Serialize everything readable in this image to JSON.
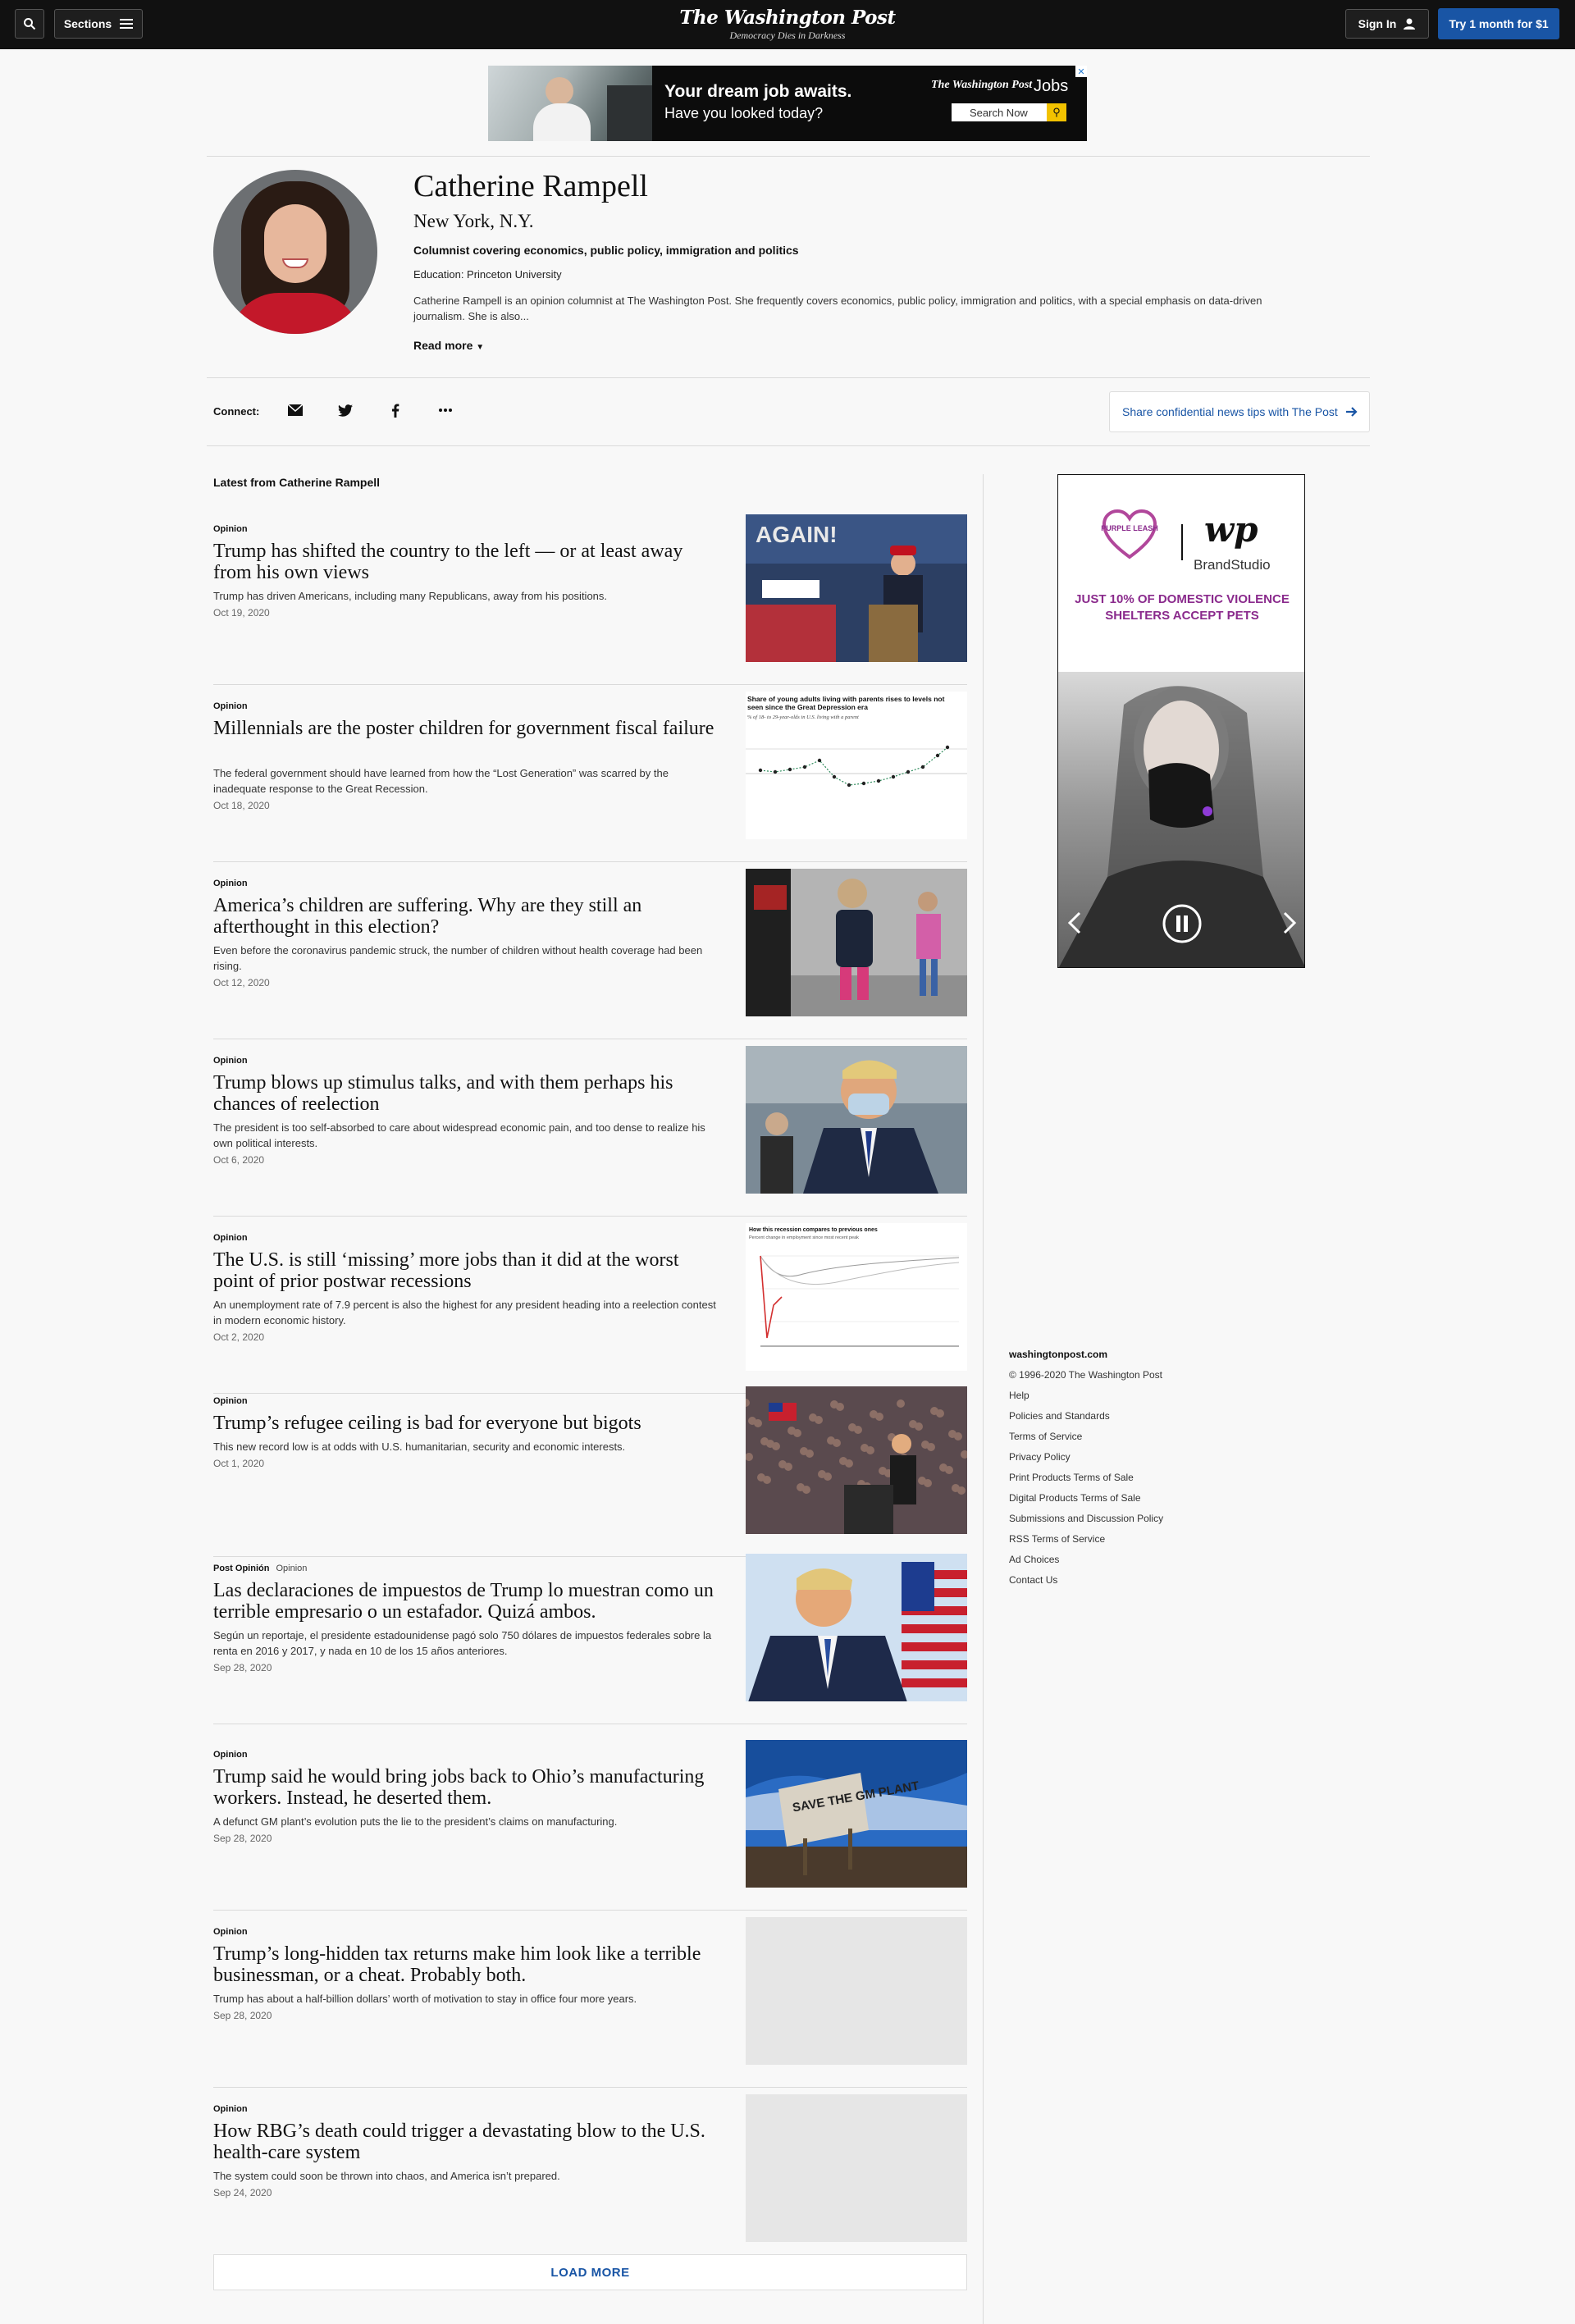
{
  "header": {
    "sections_label": "Sections",
    "brand": "The Washington Post",
    "tagline": "Democracy Dies in Darkness",
    "signin_label": "Sign In",
    "trial_label": "Try 1 month for $1",
    "icons": [
      "search-icon",
      "hamburger-icon",
      "user-icon"
    ]
  },
  "banner_ad": {
    "headline": "Your dream job awaits.",
    "subline": "Have you looked today?",
    "brand": "The Washington Post",
    "brand_suffix": "Jobs",
    "search_label": "Search Now"
  },
  "profile": {
    "name": "Catherine Rampell",
    "location": "New York, N.Y.",
    "role": "Columnist covering economics, public policy, immigration and politics",
    "education": "Education: Princeton University",
    "bio": "Catherine Rampell is an opinion columnist at The Washington Post. She frequently covers economics, public policy, immigration and politics, with a special emphasis on data-driven journalism. She is also...",
    "read_more": "Read more"
  },
  "connect": {
    "label": "Connect:",
    "icons": [
      "email-icon",
      "twitter-icon",
      "facebook-icon",
      "more-icon"
    ],
    "tips_label": "Share confidential news tips with The Post"
  },
  "latest_title": "Latest from Catherine Rampell",
  "articles": [
    {
      "kicker": "Opinion",
      "kicker_sub": "",
      "headline": "Trump has shifted the country to the left — or at least away from his own views",
      "blurb": "Trump has driven Americans, including many Republicans, away from his positions.",
      "date": "Oct 19, 2020",
      "image": "again-rally"
    },
    {
      "kicker": "Opinion",
      "kicker_sub": "",
      "headline": "Millennials are the poster children for government fiscal failure",
      "blurb": "The federal government should have learned from how the “Lost Generation” was scarred by the inadequate response to the Great Recession.",
      "date": "Oct 18, 2020",
      "image": "chart-young-adults"
    },
    {
      "kicker": "Opinion",
      "kicker_sub": "",
      "headline": "America’s children are suffering. Why are they still an afterthought in this election?",
      "blurb": "Even before the coronavirus pandemic struck, the number of children without health coverage had been rising.",
      "date": "Oct 12, 2020",
      "image": "children-walking"
    },
    {
      "kicker": "Opinion",
      "kicker_sub": "",
      "headline": "Trump blows up stimulus talks, and with them perhaps his chances of reelection",
      "blurb": "The president is too self-absorbed to care about widespread economic pain, and too dense to realize his own political interests.",
      "date": "Oct 6, 2020",
      "image": "trump-mask"
    },
    {
      "kicker": "Opinion",
      "kicker_sub": "",
      "headline": "The U.S. is still ‘missing’ more jobs than it did at the worst point of prior postwar recessions",
      "blurb": "An unemployment rate of 7.9 percent is also the highest for any president heading into a reelection contest in modern economic history.",
      "date": "Oct 2, 2020",
      "image": "chart-recession"
    },
    {
      "kicker": "Opinion",
      "kicker_sub": "",
      "headline": "Trump’s refugee ceiling is bad for everyone but bigots",
      "blurb": "This new record low is at odds with U.S. humanitarian, security and economic interests.",
      "date": "Oct 1, 2020",
      "image": "rally-crowd"
    },
    {
      "kicker": "Post Opinión",
      "kicker_sub": "Opinion",
      "headline": "Las declaraciones de impuestos de Trump lo muestran como un terrible empresario o un estafador. Quizá ambos.",
      "blurb": "Según un reportaje, el presidente estadounidense pagó solo 750 dólares de impuestos federales sobre la renta en 2016 y 2017, y nada en 10 de los 15 años anteriores.",
      "date": "Sep 28, 2020",
      "image": "trump-flag"
    },
    {
      "kicker": "Opinion",
      "kicker_sub": "",
      "headline": "Trump said he would bring jobs back to Ohio’s manufacturing workers. Instead, he deserted them.",
      "blurb": "A defunct GM plant’s evolution puts the lie to the president’s claims on manufacturing.",
      "date": "Sep 28, 2020",
      "image": "save-gm-plant"
    },
    {
      "kicker": "Opinion",
      "kicker_sub": "",
      "headline": "Trump’s long-hidden tax returns make him look like a terrible businessman, or a cheat. Probably both.",
      "blurb": "Trump has about a half-billion dollars’ worth of motivation to stay in office four more years.",
      "date": "Sep 28, 2020",
      "image": "placeholder"
    },
    {
      "kicker": "Opinion",
      "kicker_sub": "",
      "headline": "How RBG’s death could trigger a devastating blow to the U.S. health-care system",
      "blurb": "The system could soon be thrown into chaos, and America isn’t prepared.",
      "date": "Sep 24, 2020",
      "image": "placeholder"
    }
  ],
  "thumb_text": {
    "again": "AGAIN!",
    "chart1_title": "Share of young adults living with parents rises to levels not seen since the Great Depression era",
    "chart1_sub": "% of 18- to 29-year-olds in U.S. living with a parent",
    "chart2_title": "How this recession compares to previous ones",
    "chart2_sub": "Percent change in employment since most recent peak",
    "sign": "SAVE THE GM PLANT"
  },
  "side_ad": {
    "logo_left": "PURPLE LEASH",
    "logo_right": "wp",
    "logo_right_sub": "BrandStudio",
    "claim": "JUST 10% OF DOMESTIC VIOLENCE SHELTERS ACCEPT PETS"
  },
  "footer": {
    "site": "washingtonpost.com",
    "copyright": "© 1996-2020 The Washington Post",
    "links": [
      "Help",
      "Policies and Standards",
      "Terms of Service",
      "Privacy Policy",
      "Print Products Terms of Sale",
      "Digital Products Terms of Sale",
      "Submissions and Discussion Policy",
      "RSS Terms of Service",
      "Ad Choices",
      "Contact Us"
    ]
  },
  "load_more": "LOAD MORE"
}
